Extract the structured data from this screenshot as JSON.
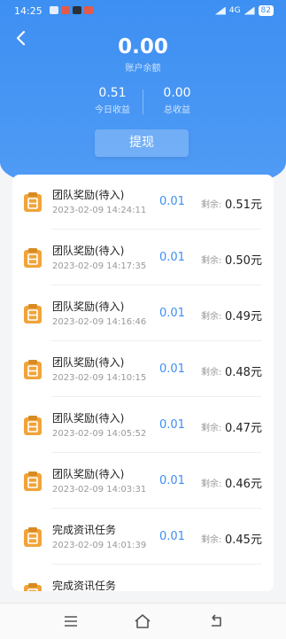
{
  "status_bar": {
    "time": "14:25",
    "network": "4G",
    "battery": "82"
  },
  "header": {
    "balance_value": "0.00",
    "balance_label": "账户余额",
    "today_value": "0.51",
    "today_label": "今日收益",
    "total_value": "0.00",
    "total_label": "总收益",
    "withdraw_label": "提现"
  },
  "icons": {
    "back": "chevron-left-icon",
    "record": "calendar-clipboard-icon"
  },
  "colors": {
    "primary": "#3d8ff2",
    "icon_orange": "#f0a43a"
  },
  "records": [
    {
      "title": "团队奖励(待入)",
      "time": "2023-02-09 14:24:11",
      "amount": "0.01",
      "remain_label": "剩余:",
      "remain": "0.51元"
    },
    {
      "title": "团队奖励(待入)",
      "time": "2023-02-09 14:17:35",
      "amount": "0.01",
      "remain_label": "剩余:",
      "remain": "0.50元"
    },
    {
      "title": "团队奖励(待入)",
      "time": "2023-02-09 14:16:46",
      "amount": "0.01",
      "remain_label": "剩余:",
      "remain": "0.49元"
    },
    {
      "title": "团队奖励(待入)",
      "time": "2023-02-09 14:10:15",
      "amount": "0.01",
      "remain_label": "剩余:",
      "remain": "0.48元"
    },
    {
      "title": "团队奖励(待入)",
      "time": "2023-02-09 14:05:52",
      "amount": "0.01",
      "remain_label": "剩余:",
      "remain": "0.47元"
    },
    {
      "title": "团队奖励(待入)",
      "time": "2023-02-09 14:03:31",
      "amount": "0.01",
      "remain_label": "剩余:",
      "remain": "0.46元"
    },
    {
      "title": "完成资讯任务",
      "time": "2023-02-09 14:01:39",
      "amount": "0.01",
      "remain_label": "剩余:",
      "remain": "0.45元"
    },
    {
      "title": "完成资讯任务",
      "time": "",
      "amount": "",
      "remain_label": "",
      "remain": ""
    }
  ]
}
